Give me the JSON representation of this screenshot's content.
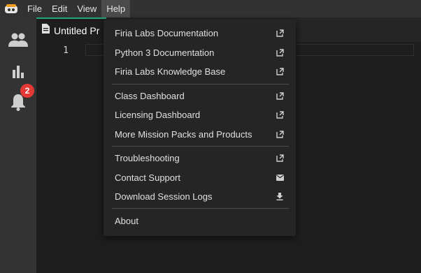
{
  "menubar": {
    "items": [
      {
        "label": "File"
      },
      {
        "label": "Edit"
      },
      {
        "label": "View"
      },
      {
        "label": "Help"
      }
    ]
  },
  "activity": {
    "notifications_badge": "2"
  },
  "tab": {
    "title": "Untitled Pr"
  },
  "editor": {
    "line_number": "1"
  },
  "help_menu": {
    "groups": [
      [
        {
          "label": "Firia Labs Documentation",
          "icon": "external-link-icon"
        },
        {
          "label": "Python 3 Documentation",
          "icon": "external-link-icon"
        },
        {
          "label": "Firia Labs Knowledge Base",
          "icon": "external-link-icon"
        }
      ],
      [
        {
          "label": "Class Dashboard",
          "icon": "external-link-icon"
        },
        {
          "label": "Licensing Dashboard",
          "icon": "external-link-icon"
        },
        {
          "label": "More Mission Packs and Products",
          "icon": "external-link-icon"
        }
      ],
      [
        {
          "label": "Troubleshooting",
          "icon": "external-link-icon"
        },
        {
          "label": "Contact Support",
          "icon": "mail-icon"
        },
        {
          "label": "Download Session Logs",
          "icon": "download-icon"
        }
      ],
      [
        {
          "label": "About",
          "icon": ""
        }
      ]
    ]
  },
  "colors": {
    "accent": "#21a67a",
    "badge": "#e53935",
    "menu_bg": "#252526"
  }
}
